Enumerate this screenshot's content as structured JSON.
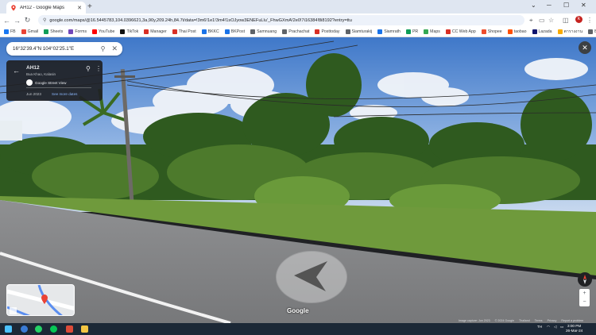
{
  "browser": {
    "tab_title": "AH12 - Google Maps",
    "tab_close": "✕",
    "new_tab": "+",
    "url": "google.com/maps/@16.5445783,104.0396621,3a,90y,209.24h,84.7t/data=!3m6!1e1!3m4!1sOJyow3ENEFuLlu'_FhwGXmA!2e0!7i16384!8i8192?entry=ttu",
    "window_controls": {
      "minimize": "─",
      "maximize": "☐",
      "close": "✕",
      "dropdown": "⌄"
    },
    "profile_initial": "k"
  },
  "bookmarks": [
    {
      "label": "FB",
      "color": "#1877f2"
    },
    {
      "label": "Gmail",
      "color": "#ea4335"
    },
    {
      "label": "Sheets",
      "color": "#0f9d58"
    },
    {
      "label": "Forms",
      "color": "#7248b9"
    },
    {
      "label": "YouTube",
      "color": "#ff0000"
    },
    {
      "label": "TikTok",
      "color": "#111111"
    },
    {
      "label": "Manager",
      "color": "#d93025"
    },
    {
      "label": "Thai Post",
      "color": "#d93025"
    },
    {
      "label": "BKKC",
      "color": "#1a73e8"
    },
    {
      "label": "BKPost",
      "color": "#1a73e8"
    },
    {
      "label": "Samnuang",
      "color": "#5f6368"
    },
    {
      "label": "Prachachat",
      "color": "#5f6368"
    },
    {
      "label": "Posttoday",
      "color": "#d93025"
    },
    {
      "label": "Siamturakij",
      "color": "#5f6368"
    },
    {
      "label": "Siamrath",
      "color": "#1a73e8"
    },
    {
      "label": "PR",
      "color": "#0f9d58"
    },
    {
      "label": "Maps",
      "color": "#34a853"
    },
    {
      "label": "CC Web App",
      "color": "#d93025"
    },
    {
      "label": "Shopee",
      "color": "#ee4d2d"
    },
    {
      "label": "taobao",
      "color": "#ff5000"
    },
    {
      "label": "Lazada",
      "color": "#0f146d"
    },
    {
      "label": "ตารางงาน",
      "color": "#f9ab00"
    },
    {
      "label": "Bing create",
      "color": "#5f6368"
    }
  ],
  "streetview": {
    "search_query": "16°32'39.4\"N 104°02'25.1\"E",
    "place_name": "AH12",
    "place_location": "Bua Khao, Kalasin",
    "provider": "Google Street View",
    "capture_date": "Jun 2023",
    "see_more": "See more dates",
    "google_watermark": "Google",
    "footer": [
      "Image capture: Jun 2023",
      "© 2024 Google",
      "Thailand",
      "Terms",
      "Privacy",
      "Report a problem"
    ],
    "zoom_in": "+",
    "zoom_out": "−"
  },
  "taskbar": {
    "lang": "TH",
    "time": "3:00 PM",
    "date": "26-Mar-24"
  }
}
